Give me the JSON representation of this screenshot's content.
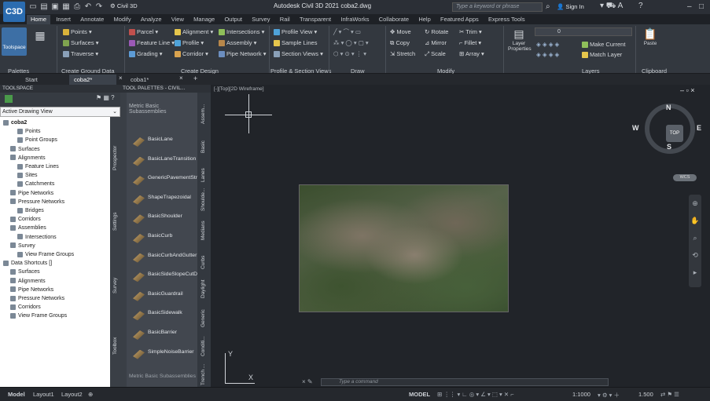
{
  "app": {
    "logo": "C3D",
    "window_title": "Autodesk Civil 3D 2021   coba2.dwg",
    "workspace": "Civil 3D",
    "search_placeholder": "Type a keyword or phrase",
    "sign_in": "Sign In"
  },
  "ribbon_tabs": [
    "Home",
    "Insert",
    "Annotate",
    "Modify",
    "Analyze",
    "View",
    "Manage",
    "Output",
    "Survey",
    "Rail",
    "Transparent",
    "InfraWorks",
    "Collaborate",
    "Help",
    "Featured Apps",
    "Express Tools"
  ],
  "ribbon": {
    "toolspace": "Toolspace",
    "palettes_title": "Palettes",
    "ground": {
      "points": "Points",
      "surfaces": "Surfaces",
      "traverse": "Traverse",
      "title": "Create Ground Data"
    },
    "design": {
      "parcel": "Parcel",
      "feature_line": "Feature Line",
      "grading": "Grading",
      "alignment": "Alignment",
      "profile": "Profile",
      "corridor": "Corridor",
      "intersections": "Intersections",
      "assembly": "Assembly",
      "pipe_network": "Pipe Network",
      "title": "Create Design"
    },
    "profile_section": {
      "profile_view": "Profile View",
      "sample_lines": "Sample Lines",
      "section_views": "Section Views",
      "title": "Profile & Section Views"
    },
    "draw_title": "Draw",
    "modify": {
      "move": "Move",
      "copy": "Copy",
      "stretch": "Stretch",
      "rotate": "Rotate",
      "mirror": "Mirror",
      "scale": "Scale",
      "trim": "Trim",
      "fillet": "Fillet",
      "array": "Array",
      "title": "Modify"
    },
    "layers": {
      "layer_props": "Layer Properties",
      "current": "0",
      "make_current": "Make Current",
      "match_layer": "Match Layer",
      "title": "Layers"
    },
    "clipboard": {
      "paste": "Paste",
      "title": "Clipboard"
    }
  },
  "doc_tabs": [
    "Start",
    "coba2*",
    "coba1*"
  ],
  "toolspace": {
    "header": "TOOLSPACE",
    "view": "Active Drawing View",
    "side_tabs": [
      "Prospector",
      "Settings",
      "Survey",
      "Toolbox"
    ],
    "tree": [
      {
        "label": "coba2",
        "level": 0,
        "bold": true
      },
      {
        "label": "Points",
        "level": 2
      },
      {
        "label": "Point Groups",
        "level": 2
      },
      {
        "label": "Surfaces",
        "level": 1
      },
      {
        "label": "Alignments",
        "level": 1
      },
      {
        "label": "Feature Lines",
        "level": 2
      },
      {
        "label": "Sites",
        "level": 2
      },
      {
        "label": "Catchments",
        "level": 2
      },
      {
        "label": "Pipe Networks",
        "level": 1
      },
      {
        "label": "Pressure Networks",
        "level": 1
      },
      {
        "label": "Bridges",
        "level": 2
      },
      {
        "label": "Corridors",
        "level": 1
      },
      {
        "label": "Assemblies",
        "level": 1
      },
      {
        "label": "Intersections",
        "level": 2
      },
      {
        "label": "Survey",
        "level": 1
      },
      {
        "label": "View Frame Groups",
        "level": 2
      },
      {
        "label": "Data Shortcuts []",
        "level": 0
      },
      {
        "label": "Surfaces",
        "level": 1
      },
      {
        "label": "Alignments",
        "level": 1
      },
      {
        "label": "Pipe Networks",
        "level": 1
      },
      {
        "label": "Pressure Networks",
        "level": 1
      },
      {
        "label": "Corridors",
        "level": 1
      },
      {
        "label": "View Frame Groups",
        "level": 1
      }
    ]
  },
  "palette": {
    "header": "TOOL PALETTES - CIVIL...",
    "title": "Metric Basic Subassemblies",
    "footer": "Metric Basic Subassemblies",
    "items": [
      "BasicLane",
      "BasicLaneTransition",
      "GenericPavementStructure",
      "ShapeTrapezoidal",
      "BasicShoulder",
      "BasicCurb",
      "BasicCurbAndGutter",
      "BasicSideSlopeCutDitch",
      "BasicGuardrail",
      "BasicSidewalk",
      "BasicBarrier",
      "SimpleNoiseBarrier"
    ],
    "side_tabs": [
      "Assem...",
      "Basic",
      "Lanes",
      "Shoulde...",
      "Medians",
      "Curbs",
      "Daylight",
      "Generic",
      "Conditi...",
      "Trench ..."
    ]
  },
  "viewport": {
    "label": "[-][Top][2D Wireframe]",
    "compass": {
      "n": "N",
      "s": "S",
      "e": "E",
      "w": "W",
      "cube": "TOP"
    },
    "wcs": "WCS",
    "command_placeholder": "Type a command",
    "axis_y": "Y",
    "axis_x": "X"
  },
  "status": {
    "model_tab": "Model",
    "layout1": "Layout1",
    "layout2": "Layout2",
    "model": "MODEL",
    "scale1": "1:1000",
    "scale2": "1.500"
  }
}
